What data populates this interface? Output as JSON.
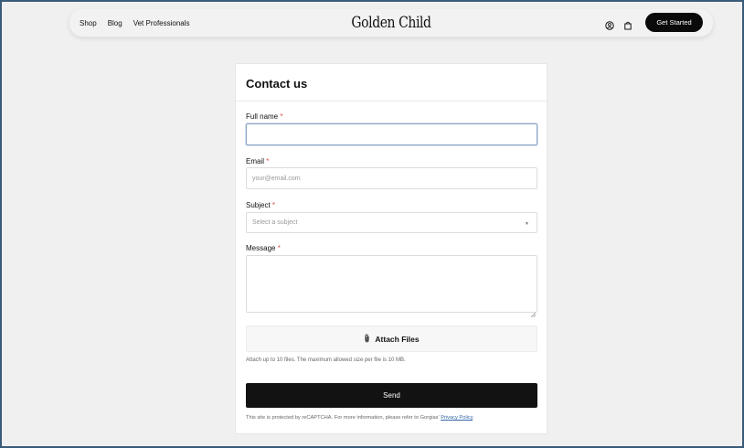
{
  "nav": {
    "links": [
      "Shop",
      "Blog",
      "Vet Professionals"
    ],
    "logo": "Golden Child",
    "cta": "Get Started",
    "icons": [
      "account-icon",
      "bag-icon"
    ]
  },
  "form": {
    "title": "Contact us",
    "required_mark": "*",
    "full_name": {
      "label": "Full name",
      "value": "",
      "placeholder": ""
    },
    "email": {
      "label": "Email",
      "placeholder": "your@email.com"
    },
    "subject": {
      "label": "Subject",
      "selected": "Select a subject"
    },
    "message": {
      "label": "Message",
      "value": ""
    },
    "attach_label": "Attach Files",
    "attach_hint": "Attach up to 10 files. The maximum allowed size per file is 10 MB.",
    "send_label": "Send",
    "recaptcha_text": "This site is protected by reCAPTCHA. For more information, please refer to Gorgias'",
    "privacy_link": "Privacy Policy",
    "recaptcha_end": "."
  },
  "colors": {
    "accent": "#0a0a0a",
    "required": "#d9534f",
    "link": "#3366aa",
    "background": "#f0f0f0"
  }
}
